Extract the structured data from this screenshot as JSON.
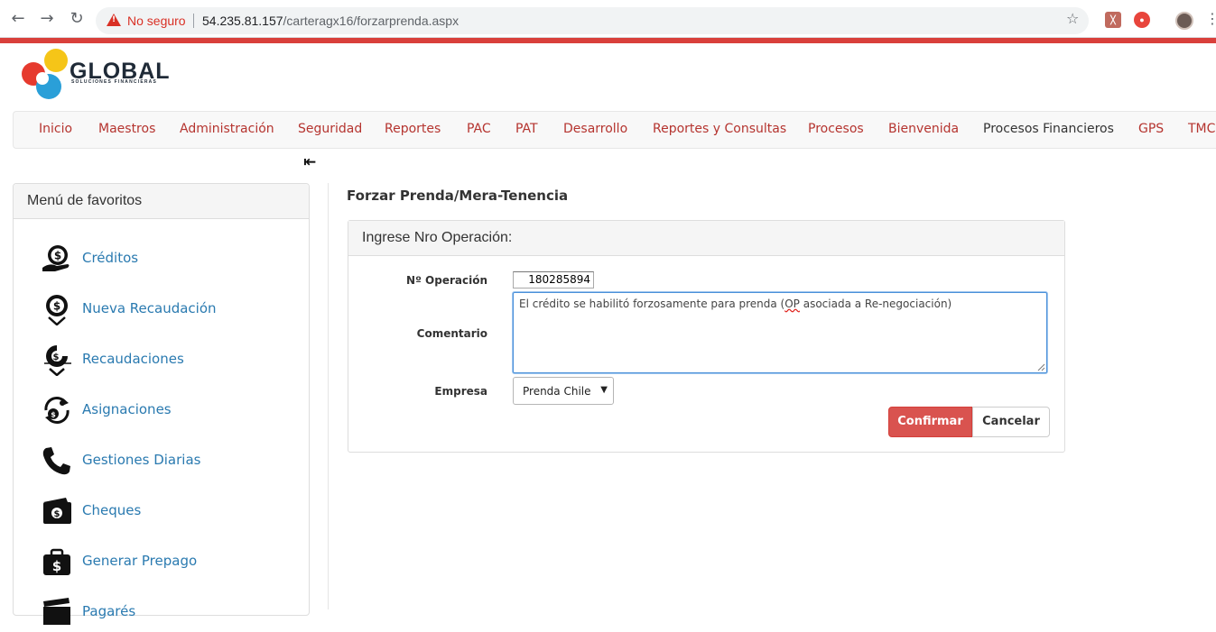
{
  "browser": {
    "security_label": "No seguro",
    "url_host": "54.235.81.157",
    "url_path": "/carteragx16/forzarprenda.aspx"
  },
  "logo": {
    "name": "GLOBAL",
    "tagline": "SOLUCIONES FINANCIERAS"
  },
  "navbar": {
    "items": [
      "Inicio",
      "Maestros",
      "Administración",
      "Seguridad",
      "Reportes",
      "PAC",
      "PAT",
      "Desarrollo",
      "Reportes y Consultas",
      "Procesos",
      "Bienvenida",
      "Procesos Financieros",
      "GPS",
      "TMC"
    ]
  },
  "sidebar": {
    "title": "Menú de favoritos",
    "items": [
      {
        "label": "Créditos",
        "icon": "credit-hand-icon"
      },
      {
        "label": "Nueva Recaudación",
        "icon": "new-collection-icon"
      },
      {
        "label": "Recaudaciones",
        "icon": "collections-icon"
      },
      {
        "label": "Asignaciones",
        "icon": "assignments-icon"
      },
      {
        "label": "Gestiones Diarias",
        "icon": "phone-icon"
      },
      {
        "label": "Cheques",
        "icon": "cheque-icon"
      },
      {
        "label": "Generar Prepago",
        "icon": "prepay-bag-icon"
      },
      {
        "label": "Pagarés",
        "icon": "promissory-note-icon"
      }
    ]
  },
  "main": {
    "title": "Forzar Prenda/Mera-Tenencia",
    "panel_title": "Ingrese Nro Operación:",
    "form": {
      "operation_label": "Nº Operación",
      "operation_value": "180285894",
      "comment_label": "Comentario",
      "comment_before": "El crédito se habilitó forzosamente para prenda (",
      "comment_flagged": "OP",
      "comment_after": " asociada a Re-negociación)",
      "company_label": "Empresa",
      "company_value": "Prenda Chile",
      "confirm_label": "Confirmar",
      "cancel_label": "Cancelar"
    }
  },
  "colors": {
    "brand_red": "#d9403b",
    "nav_text": "#b5342f",
    "link_blue": "#2a7ab0",
    "confirm_bg": "#d9534f"
  }
}
